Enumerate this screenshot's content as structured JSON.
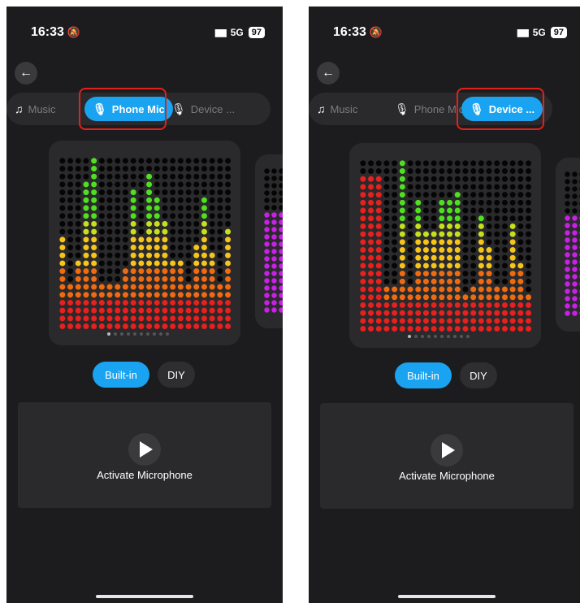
{
  "screens": [
    {
      "status": {
        "time": "16:33",
        "network": "5G",
        "battery": "97"
      },
      "tabs": [
        {
          "label": "Music",
          "icon": "music-note-icon"
        },
        {
          "label": "Phone Mic",
          "icon": "microphone-icon"
        },
        {
          "label": "Device ...",
          "icon": "microphone-icon"
        }
      ],
      "active_tab": "Phone Mic",
      "mode_buttons": {
        "builtin": "Built-in",
        "diy": "DIY"
      },
      "activate_label": "Activate Microphone",
      "page_indicator": {
        "total": 10,
        "current": 1
      }
    },
    {
      "status": {
        "time": "16:33",
        "network": "5G",
        "battery": "97"
      },
      "tabs": [
        {
          "label": "Music",
          "icon": "music-note-icon"
        },
        {
          "label": "Phone Mic",
          "icon": "microphone-icon"
        },
        {
          "label": "Device ...",
          "icon": "microphone-icon"
        }
      ],
      "active_tab": "Device ...",
      "mode_buttons": {
        "builtin": "Built-in",
        "diy": "DIY"
      },
      "activate_label": "Activate Microphone",
      "page_indicator": {
        "total": 10,
        "current": 1
      }
    }
  ],
  "colors": {
    "accent": "#1aa3f0",
    "highlight": "#e0211e"
  }
}
